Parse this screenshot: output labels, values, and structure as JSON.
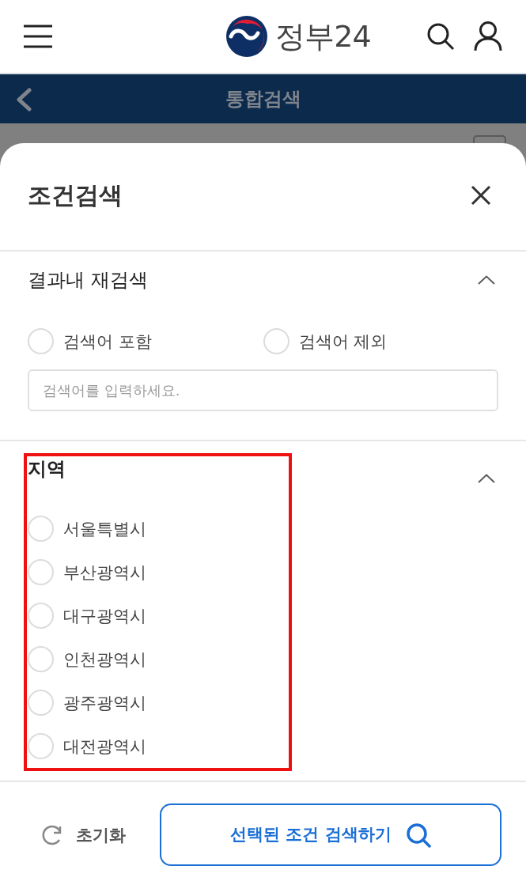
{
  "header": {
    "logo_text": "정부24"
  },
  "title_bar": {
    "title": "통합검색"
  },
  "sheet": {
    "title": "조건검색",
    "sections": [
      {
        "kind": "keyword",
        "title": "결과내 재검색",
        "expanded": true,
        "highlighted": false,
        "options": [
          {
            "label": "검색어 포함",
            "selected": false
          },
          {
            "label": "검색어 제외",
            "selected": false
          }
        ],
        "input": {
          "placeholder": "검색어를 입력하세요."
        }
      },
      {
        "kind": "region",
        "title": "지역",
        "expanded": true,
        "highlighted": true,
        "options": [
          {
            "label": "서울특별시",
            "selected": false
          },
          {
            "label": "부산광역시",
            "selected": false
          },
          {
            "label": "대구광역시",
            "selected": false
          },
          {
            "label": "인천광역시",
            "selected": false
          },
          {
            "label": "광주광역시",
            "selected": false
          },
          {
            "label": "대전광역시",
            "selected": false
          }
        ]
      }
    ]
  },
  "footer": {
    "reset_label": "초기화",
    "search_button": "선택된 조건 검색하기"
  }
}
